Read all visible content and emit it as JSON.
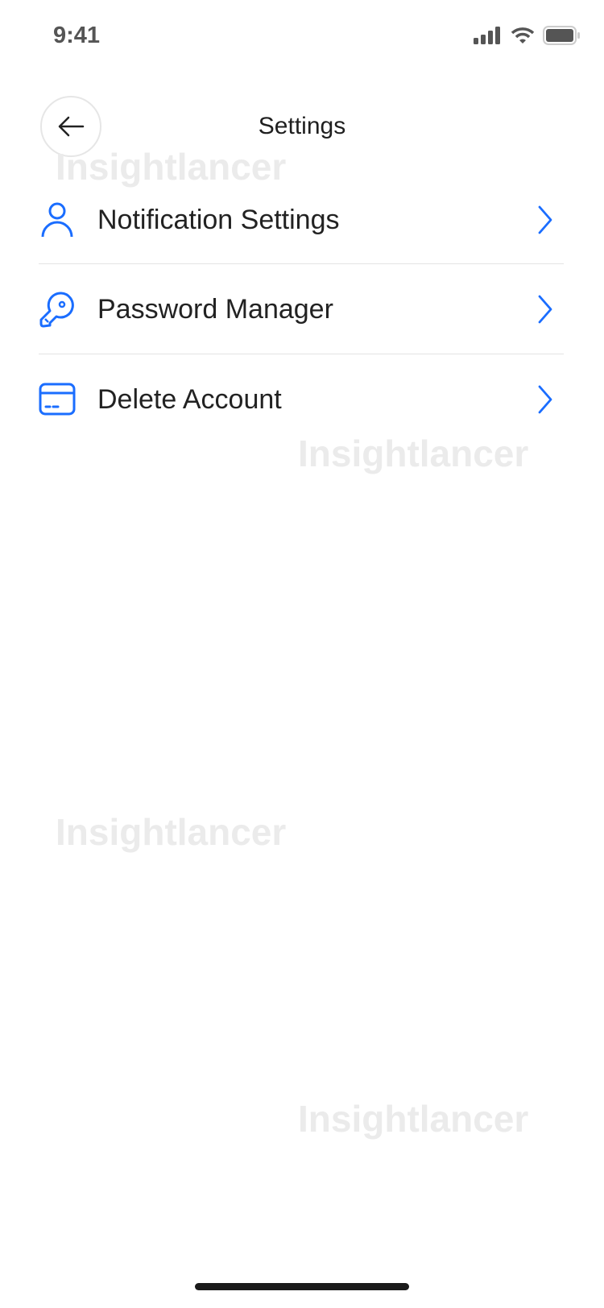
{
  "status_bar": {
    "time": "9:41"
  },
  "header": {
    "title": "Settings",
    "back_icon": "arrow-left-icon"
  },
  "menu": [
    {
      "label": "Notification Settings",
      "icon": "user-icon"
    },
    {
      "label": "Password Manager",
      "icon": "key-icon"
    },
    {
      "label": "Delete Account",
      "icon": "card-icon"
    }
  ],
  "watermark": "Insightlancer",
  "colors": {
    "accent": "#1a6dff",
    "text": "#222222",
    "divider": "#e4e4e4"
  }
}
